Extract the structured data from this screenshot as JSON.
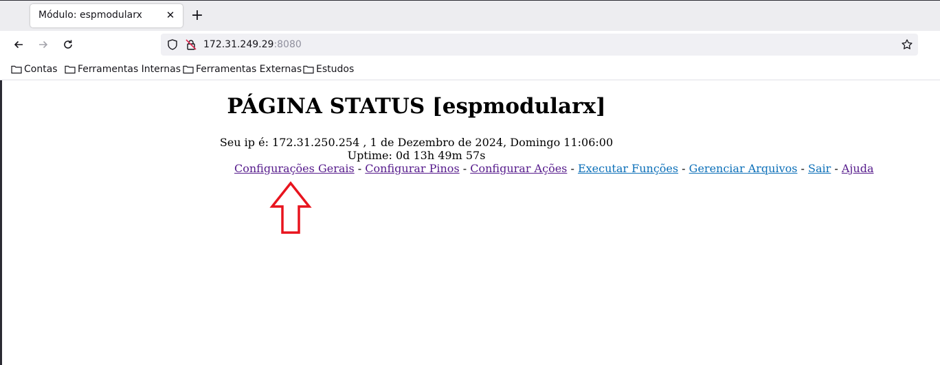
{
  "browser": {
    "tab_title": "Módulo: espmodularx",
    "url_host": "172.31.249.29",
    "url_port": ":8080",
    "bookmarks": [
      "Contas",
      "Ferramentas Internas",
      "Ferramentas Externas",
      "Estudos"
    ]
  },
  "page": {
    "title": "PÁGINA STATUS [espmodularx]",
    "ip_line": "Seu ip é: 172.31.250.254 , 1 de Dezembro de 2024, Domingo 11:06:00",
    "uptime_line": "Uptime: 0d 13h 49m 57s",
    "separator": " - ",
    "links": [
      {
        "label": "Configurações Gerais",
        "visited": true
      },
      {
        "label": "Configurar Pinos",
        "visited": true
      },
      {
        "label": "Configurar Ações",
        "visited": true
      },
      {
        "label": "Executar Funções",
        "visited": false
      },
      {
        "label": "Gerenciar Arquivos",
        "visited": false
      },
      {
        "label": "Sair",
        "visited": false
      },
      {
        "label": "Ajuda",
        "visited": true
      }
    ]
  },
  "colors": {
    "visited_link": "#551a8b",
    "unvisited_link": "#0b6fb8",
    "annotation_arrow": "#e8141e"
  }
}
